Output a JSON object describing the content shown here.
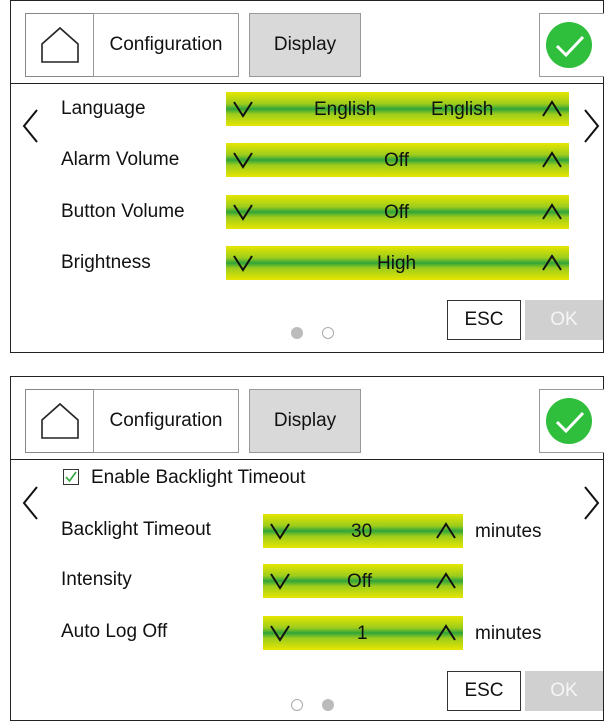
{
  "screens": [
    {
      "tabs": {
        "configuration": "Configuration",
        "display": "Display"
      },
      "rows": [
        {
          "label": "Language",
          "value": "English",
          "value2": "English"
        },
        {
          "label": "Alarm Volume",
          "value": "Off"
        },
        {
          "label": "Button Volume",
          "value": "Off"
        },
        {
          "label": "Brightness",
          "value": "High"
        }
      ],
      "buttons": {
        "esc": "ESC",
        "ok": "OK"
      },
      "page_indicator": {
        "current": 1,
        "total": 2
      }
    },
    {
      "tabs": {
        "configuration": "Configuration",
        "display": "Display"
      },
      "checkbox": {
        "label": "Enable Backlight Timeout",
        "checked": true
      },
      "rows": [
        {
          "label": "Backlight Timeout",
          "value": "30",
          "unit": "minutes"
        },
        {
          "label": "Intensity",
          "value": "Off"
        },
        {
          "label": "Auto Log Off",
          "value": "1",
          "unit": "minutes"
        }
      ],
      "buttons": {
        "esc": "ESC",
        "ok": "OK"
      },
      "page_indicator": {
        "current": 2,
        "total": 2
      }
    }
  ],
  "colors": {
    "confirm": "#2fbf3d",
    "spinner_yellow": "#e6e600",
    "spinner_green": "#2fa43a",
    "tab_active": "#d9d9d9",
    "ok_disabled": "#d0d0d0"
  },
  "icons": {
    "home": "home-icon",
    "confirm": "check-circle-icon",
    "prev": "chevron-left-icon",
    "next": "chevron-right-icon",
    "decrease": "chevron-down-icon",
    "increase": "chevron-up-icon"
  }
}
